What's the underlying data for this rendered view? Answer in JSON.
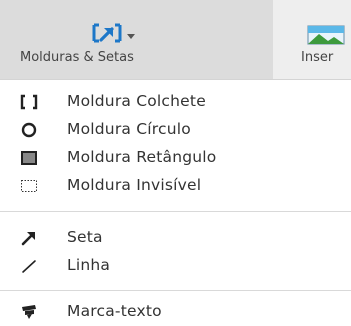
{
  "toolbar": {
    "frames_arrows_label": "Molduras & Setas",
    "insert_label": "Inser",
    "accent_color": "#1d77c8"
  },
  "menu": {
    "frame_group": [
      {
        "label": "Moldura Colchete",
        "icon": "bracket-frame-icon"
      },
      {
        "label": "Moldura Círculo",
        "icon": "circle-frame-icon"
      },
      {
        "label": "Moldura Retângulo",
        "icon": "rectangle-frame-icon"
      },
      {
        "label": "Moldura Invisível",
        "icon": "invisible-frame-icon"
      }
    ],
    "line_group": [
      {
        "label": "Seta",
        "icon": "arrow-icon"
      },
      {
        "label": "Linha",
        "icon": "line-icon"
      }
    ],
    "marker_group": [
      {
        "label": "Marca-texto",
        "icon": "highlighter-icon"
      }
    ]
  }
}
